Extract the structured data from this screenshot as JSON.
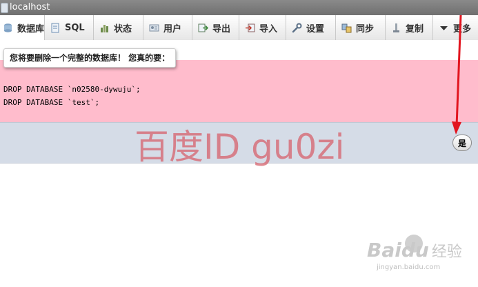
{
  "window": {
    "title": "localhost"
  },
  "tabs": [
    {
      "label": "数据库",
      "icon": "database-icon",
      "active": true
    },
    {
      "label": "SQL",
      "icon": "sql-icon"
    },
    {
      "label": "状态",
      "icon": "status-icon"
    },
    {
      "label": "用户",
      "icon": "users-icon"
    },
    {
      "label": "导出",
      "icon": "export-icon"
    },
    {
      "label": "导入",
      "icon": "import-icon"
    },
    {
      "label": "设置",
      "icon": "wrench-icon"
    },
    {
      "label": "同步",
      "icon": "sync-icon"
    },
    {
      "label": "复制",
      "icon": "replication-icon"
    },
    {
      "label": "更多",
      "icon": "chevron-down-icon"
    }
  ],
  "dialog": {
    "message": "您将要删除一个完整的数据库！ 您真的要：",
    "sql_lines": [
      "DROP DATABASE `n02580-dywuju`;",
      "DROP DATABASE `test`;"
    ],
    "confirm_label": "是"
  },
  "watermark": {
    "text": "百度ID gu0zi"
  },
  "baidu_logo": {
    "brand": "Baidu",
    "product": "经验",
    "url": "jingyan.baidu.com"
  },
  "colors": {
    "sql_background": "#ffbccc",
    "button_bar": "#d5dce7",
    "annotation_arrow": "#e2151f",
    "watermark": "#d6626c"
  }
}
